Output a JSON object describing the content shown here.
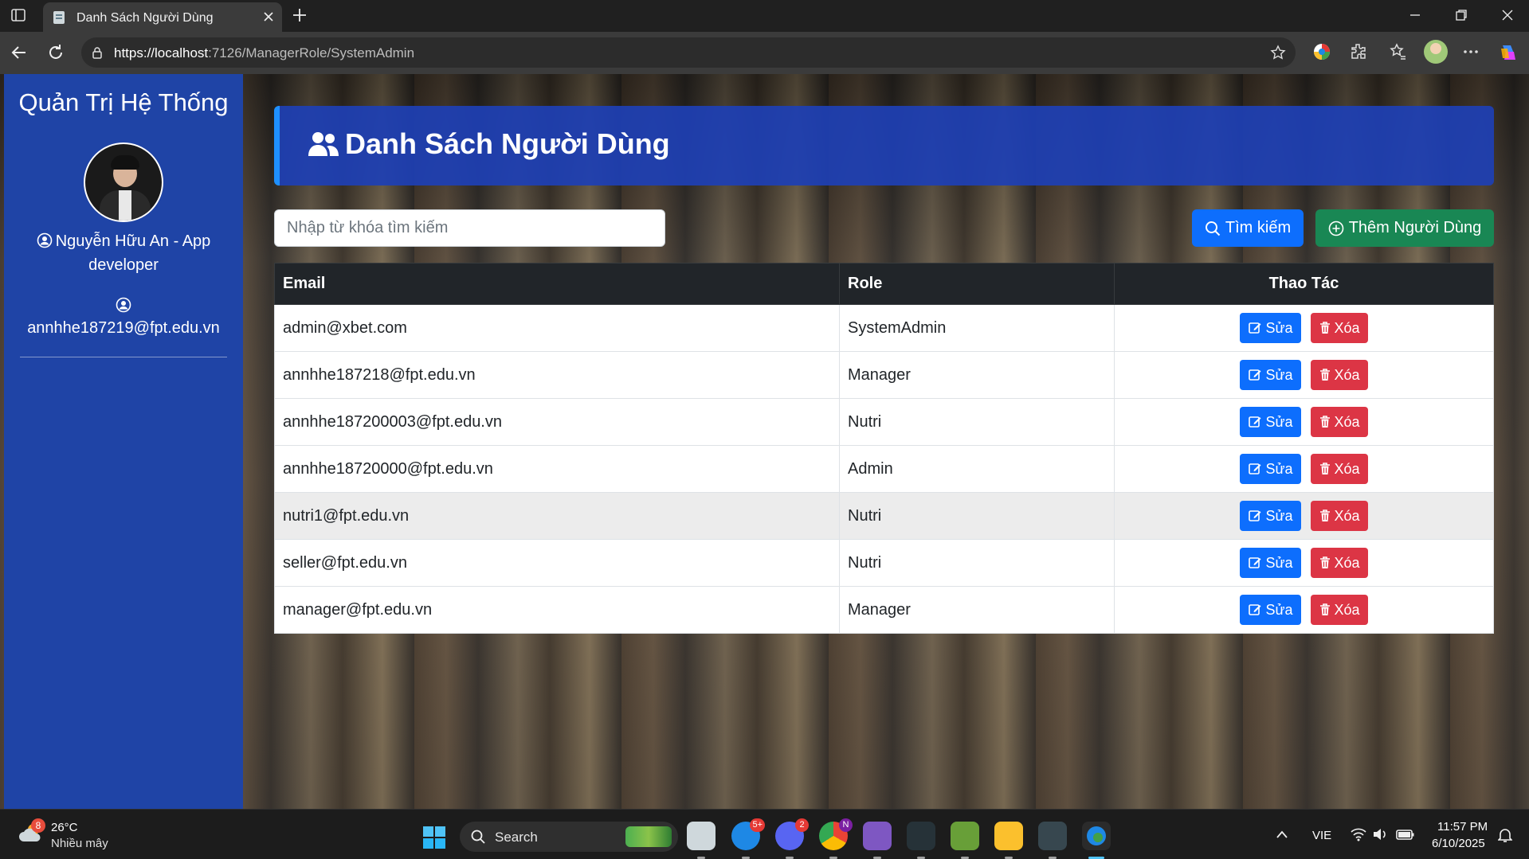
{
  "browser": {
    "tab_title": "Danh Sách Người Dùng",
    "url_host": "https://localhost",
    "url_path": ":7126/ManagerRole/SystemAdmin"
  },
  "sidebar": {
    "title": "Quản Trị Hệ Thống",
    "user_name": "Nguyễn Hữu An - App developer",
    "user_email": "annhhe187219@fpt.edu.vn"
  },
  "header": {
    "title": "Danh Sách Người Dùng"
  },
  "search": {
    "placeholder": "Nhập từ khóa tìm kiếm",
    "search_label": "Tìm kiếm",
    "add_label": "Thêm Người Dùng"
  },
  "table": {
    "columns": [
      "Email",
      "Role",
      "Thao Tác"
    ],
    "edit_label": "Sửa",
    "delete_label": "Xóa",
    "rows": [
      {
        "email": "admin@xbet.com",
        "role": "SystemAdmin"
      },
      {
        "email": "annhhe187218@fpt.edu.vn",
        "role": "Manager"
      },
      {
        "email": "annhhe187200003@fpt.edu.vn",
        "role": "Nutri"
      },
      {
        "email": "annhhe18720000@fpt.edu.vn",
        "role": "Admin"
      },
      {
        "email": "nutri1@fpt.edu.vn",
        "role": "Nutri"
      },
      {
        "email": "seller@fpt.edu.vn",
        "role": "Nutri"
      },
      {
        "email": "manager@fpt.edu.vn",
        "role": "Manager"
      }
    ]
  },
  "taskbar": {
    "weather_temp": "26°C",
    "weather_desc": "Nhiều mây",
    "weather_badge": "8",
    "search_label": "Search",
    "zalo_badge": "5+",
    "discord_badge": "2",
    "chrome_badge": "N",
    "language": "VIE",
    "time": "11:57 PM",
    "date": "6/10/2025"
  },
  "colors": {
    "sidebar": "#1f44a6",
    "banner": "#1e40b4",
    "primary": "#0d6efd",
    "success": "#198754",
    "danger": "#dc3545",
    "table_header": "#212529"
  }
}
